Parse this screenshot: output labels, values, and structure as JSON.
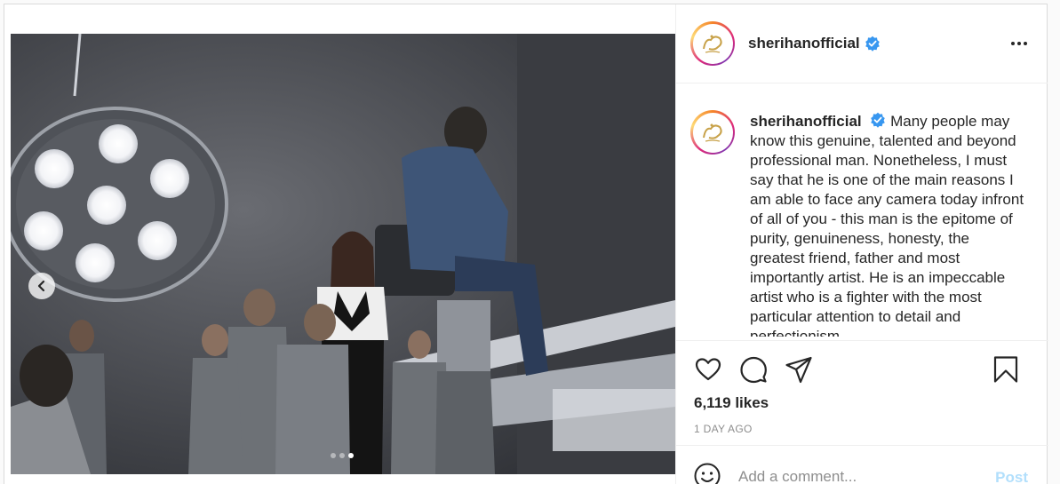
{
  "header": {
    "username": "sherihanofficial",
    "verified": true,
    "more_icon": "more-horizontal-icon"
  },
  "media": {
    "carousel_total": 3,
    "carousel_active": 3,
    "prev_icon": "chevron-left-icon"
  },
  "caption": {
    "username": "sherihanofficial",
    "text": "Many people may know this genuine, talented and beyond professional man. Nonetheless, I must say that he is one of the main reasons I am able to face any camera today infront of all of you - this man is the epitome of purity, genuineness, honesty, the greatest friend, father and most importantly artist. He is an impeccable artist who is a fighter with the most particular attention to detail and perfectionism"
  },
  "actions": {
    "icons": [
      "heart-icon",
      "comment-icon",
      "share-icon",
      "bookmark-icon"
    ],
    "likes": "6,119 likes",
    "time_ago": "1 DAY AGO"
  },
  "comment": {
    "placeholder": "Add a comment...",
    "post_label": "Post",
    "emoji_icon": "smiley-icon"
  },
  "colors": {
    "border": "#dbdbdb",
    "verified": "#3897f0",
    "post_disabled": "#b2dffc",
    "muted": "#8e8e8e"
  }
}
